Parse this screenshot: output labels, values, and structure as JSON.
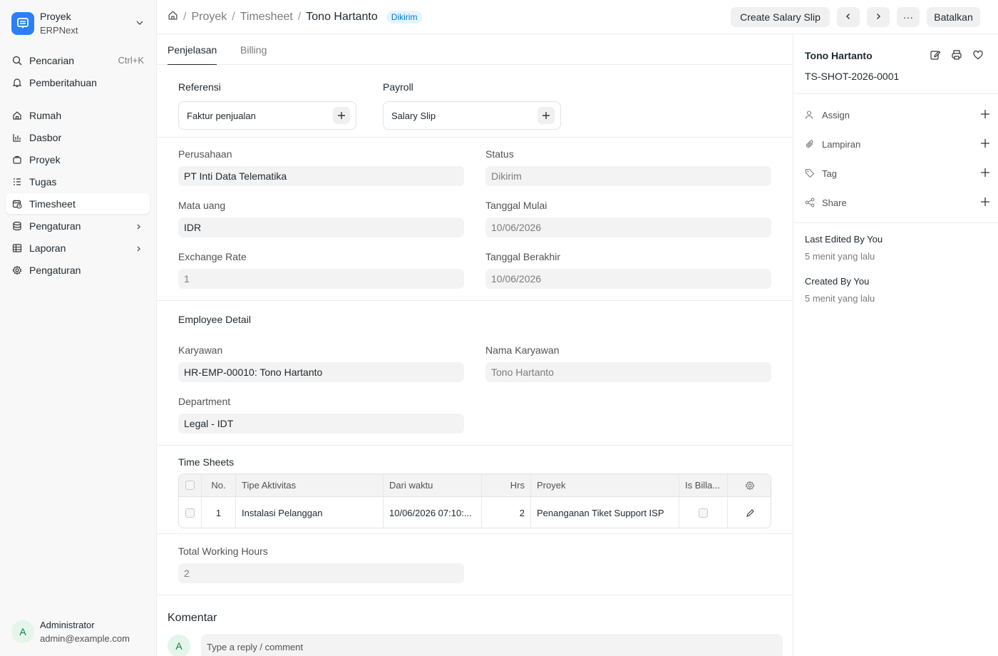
{
  "app": {
    "name": "Proyek",
    "sub": "ERPNext"
  },
  "sidebar": {
    "search_label": "Pencarian",
    "search_shortcut": "Ctrl+K",
    "notifications_label": "Pemberitahuan",
    "items": [
      {
        "label": "Rumah",
        "icon": "home-icon"
      },
      {
        "label": "Dasbor",
        "icon": "chart-icon"
      },
      {
        "label": "Proyek",
        "icon": "briefcase-icon"
      },
      {
        "label": "Tugas",
        "icon": "list-icon"
      },
      {
        "label": "Timesheet",
        "icon": "calendar-clock-icon",
        "active": true
      },
      {
        "label": "Pengaturan",
        "icon": "database-icon",
        "chevron": true
      },
      {
        "label": "Laporan",
        "icon": "table-icon",
        "chevron": true
      },
      {
        "label": "Pengaturan",
        "icon": "gear-icon"
      }
    ]
  },
  "user": {
    "initial": "A",
    "name": "Administrator",
    "email": "admin@example.com"
  },
  "header": {
    "breadcrumbs": [
      "Proyek",
      "Timesheet",
      "Tono Hartanto"
    ],
    "status_badge": "Dikirim",
    "create_button": "Create Salary Slip",
    "more_label": "···",
    "cancel_button": "Batalkan"
  },
  "tabs": [
    "Penjelasan",
    "Billing"
  ],
  "references": {
    "title_ref": "Referensi",
    "title_payroll": "Payroll",
    "sales_invoice": "Faktur penjualan",
    "salary_slip": "Salary Slip"
  },
  "details": {
    "company_label": "Perusahaan",
    "company": "PT Inti Data Telematika",
    "status_label": "Status",
    "status": "Dikirim",
    "currency_label": "Mata uang",
    "currency": "IDR",
    "start_label": "Tanggal Mulai",
    "start": "10/06/2026",
    "rate_label": "Exchange Rate",
    "rate": "1",
    "end_label": "Tanggal Berakhir",
    "end": "10/06/2026"
  },
  "employee": {
    "section": "Employee Detail",
    "employee_label": "Karyawan",
    "employee": "HR-EMP-00010: Tono Hartanto",
    "name_label": "Nama Karyawan",
    "name": "Tono Hartanto",
    "dept_label": "Department",
    "dept": "Legal - IDT"
  },
  "timesheets": {
    "section": "Time Sheets",
    "columns": [
      "No.",
      "Tipe Aktivitas",
      "Dari waktu",
      "Hrs",
      "Proyek",
      "Is Billa..."
    ],
    "rows": [
      {
        "no": "1",
        "activity": "Instalasi Pelanggan",
        "from": "10/06/2026 07:10:...",
        "hrs": "2",
        "project": "Penanganan Tiket Support ISP"
      }
    ]
  },
  "total": {
    "label": "Total Working Hours",
    "value": "2"
  },
  "comments": {
    "title": "Komentar",
    "avatar": "A",
    "placeholder": "Type a reply / comment"
  },
  "side": {
    "title": "Tono Hartanto",
    "id": "TS-SHOT-2026-0001",
    "assign": "Assign",
    "attachments": "Lampiran",
    "tags": "Tag",
    "share": "Share",
    "last_edited": "Last Edited By You",
    "last_edited_time": "5 menit yang lalu",
    "created": "Created By You",
    "created_time": "5 menit yang lalu"
  }
}
